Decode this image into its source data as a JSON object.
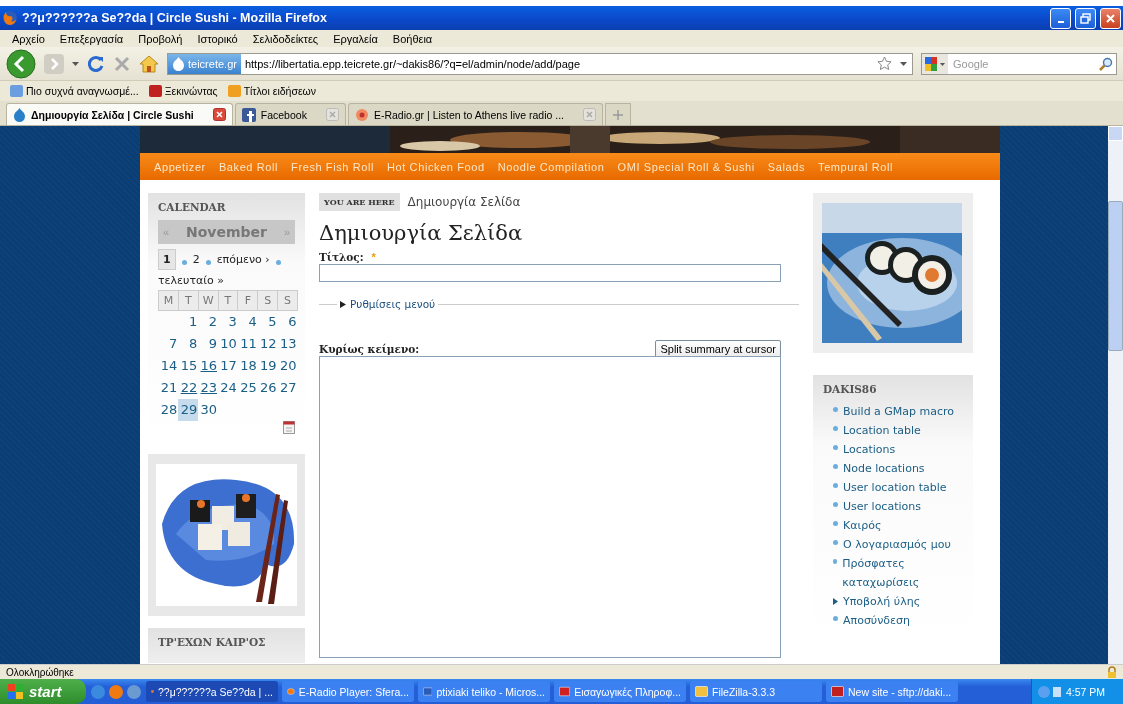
{
  "window": {
    "title": "??μ??????a Se??da | Circle Sushi - Mozilla Firefox"
  },
  "menu": [
    "Αρχείο",
    "Επεξεργασία",
    "Προβολή",
    "Ιστορικό",
    "Σελιδοδείκτες",
    "Εργαλεία",
    "Βοήθεια"
  ],
  "address_bar": {
    "site": "teicrete.gr",
    "url": "https://libertatia.epp.teicrete.gr/~dakis86/?q=el/admin/node/add/page"
  },
  "search": {
    "placeholder": "Google"
  },
  "bookmarks": [
    "Πιο συχνά αναγνωσμέ...",
    "Ξεκινώντας",
    "Τίτλοι ειδήσεων"
  ],
  "tabs": [
    {
      "label": "Δημιουργία Σελίδα | Circle Sushi",
      "selected": true
    },
    {
      "label": "Facebook",
      "selected": false
    },
    {
      "label": "E-Radio.gr | Listen to Athens live radio ...",
      "selected": false
    }
  ],
  "site_nav": [
    "Appetizer",
    "Baked Roll",
    "Fresh Fish Roll",
    "Hot Chicken Food",
    "Noodle Compilation",
    "OMI Special Roll & Sushi",
    "Salads",
    "Tempural Roll"
  ],
  "calendar": {
    "title": "CALENDAR",
    "prev": "«",
    "month": "November",
    "next": "»",
    "pager": [
      {
        "label": "1",
        "selected": true
      },
      {
        "label": "2",
        "selected": false
      },
      {
        "label": "επόμενο ›",
        "selected": false
      },
      {
        "label": "τελευταίο »",
        "selected": false
      }
    ],
    "weekdays": [
      "M",
      "T",
      "W",
      "T",
      "F",
      "S",
      "S"
    ],
    "weeks": [
      {
        "kind": "leading_gap",
        "days": [
          {
            "day": "1",
            "link": false,
            "today": false
          },
          {
            "day": "2",
            "link": false,
            "today": false
          },
          {
            "day": "3",
            "link": false,
            "today": false
          },
          {
            "day": "4",
            "link": false,
            "today": false
          },
          {
            "day": "5",
            "link": false,
            "today": false
          },
          {
            "day": "6",
            "link": false,
            "today": false
          }
        ]
      },
      {
        "kind": "full",
        "days": [
          {
            "day": "7",
            "link": false,
            "today": false
          },
          {
            "day": "8",
            "link": false,
            "today": false
          },
          {
            "day": "9",
            "link": false,
            "today": false
          },
          {
            "day": "10",
            "link": false,
            "today": false
          },
          {
            "day": "11",
            "link": false,
            "today": false
          },
          {
            "day": "12",
            "link": false,
            "today": false
          },
          {
            "day": "13",
            "link": false,
            "today": false
          }
        ]
      },
      {
        "kind": "full",
        "days": [
          {
            "day": "14",
            "link": false,
            "today": false
          },
          {
            "day": "15",
            "link": false,
            "today": false
          },
          {
            "day": "16",
            "link": true,
            "today": false
          },
          {
            "day": "17",
            "link": false,
            "today": false
          },
          {
            "day": "18",
            "link": false,
            "today": false
          },
          {
            "day": "19",
            "link": false,
            "today": false
          },
          {
            "day": "20",
            "link": false,
            "today": false
          }
        ]
      },
      {
        "kind": "full",
        "days": [
          {
            "day": "21",
            "link": false,
            "today": false
          },
          {
            "day": "22",
            "link": true,
            "today": false
          },
          {
            "day": "23",
            "link": true,
            "today": false
          },
          {
            "day": "24",
            "link": false,
            "today": false
          },
          {
            "day": "25",
            "link": false,
            "today": false
          },
          {
            "day": "26",
            "link": false,
            "today": false
          },
          {
            "day": "27",
            "link": false,
            "today": false
          }
        ]
      },
      {
        "kind": "trailing_gap",
        "days": [
          {
            "day": "28",
            "link": false,
            "today": false
          },
          {
            "day": "29",
            "link": false,
            "today": true
          },
          {
            "day": "30",
            "link": false,
            "today": false
          }
        ]
      }
    ]
  },
  "weather": {
    "title": "ΤΡ'ΕΧΩΝ ΚΑΙΡ'ΟΣ"
  },
  "breadcrumb": {
    "label": "YOU ARE HERE",
    "current": "Δημιουργία Σελίδα"
  },
  "heading": "Δημιουργία Σελίδα",
  "form": {
    "title_label": "Τίτλος:",
    "required_mark": "*",
    "menu_settings": {
      "legend": "Ρυθμίσεις μενού",
      "expanded": false
    },
    "body_label": "Κυρίως κείμενο:",
    "split_button": "Split summary at cursor"
  },
  "user_block": {
    "title": "DAKIS86",
    "links": [
      {
        "label": "Build a GMap macro",
        "kind": "leaf"
      },
      {
        "label": "Location table",
        "kind": "leaf"
      },
      {
        "label": "Locations",
        "kind": "leaf"
      },
      {
        "label": "Node locations",
        "kind": "leaf"
      },
      {
        "label": "User location table",
        "kind": "leaf"
      },
      {
        "label": "User locations",
        "kind": "leaf"
      },
      {
        "label": "Καιρός",
        "kind": "leaf"
      },
      {
        "label": "Ο λογαριασμός μου",
        "kind": "leaf"
      },
      {
        "label": "Πρόσφατες καταχωρίσεις",
        "kind": "leaf"
      },
      {
        "label": "Υποβολή ύλης",
        "kind": "collapsed"
      },
      {
        "label": "Αποσύνδεση",
        "kind": "leaf"
      }
    ]
  },
  "status_bar": {
    "text": "Ολοκληρώθηκε"
  },
  "taskbar": {
    "start": "start",
    "tasks": [
      {
        "label": "??μ??????a Se??da | ...",
        "kind": "firefox",
        "selected": true
      },
      {
        "label": "E-Radio Player: Sfera...",
        "kind": "firefox",
        "selected": false
      },
      {
        "label": "ptixiaki teliko - Micros...",
        "kind": "word",
        "selected": false
      },
      {
        "label": "Εισαγωγικές Πληροφ...",
        "kind": "pdf",
        "selected": false
      },
      {
        "label": "FileZilla-3.3.3",
        "kind": "folder",
        "selected": false
      },
      {
        "label": "New site - sftp://daki...",
        "kind": "filezilla",
        "selected": false
      }
    ],
    "time": "4:57 PM"
  }
}
